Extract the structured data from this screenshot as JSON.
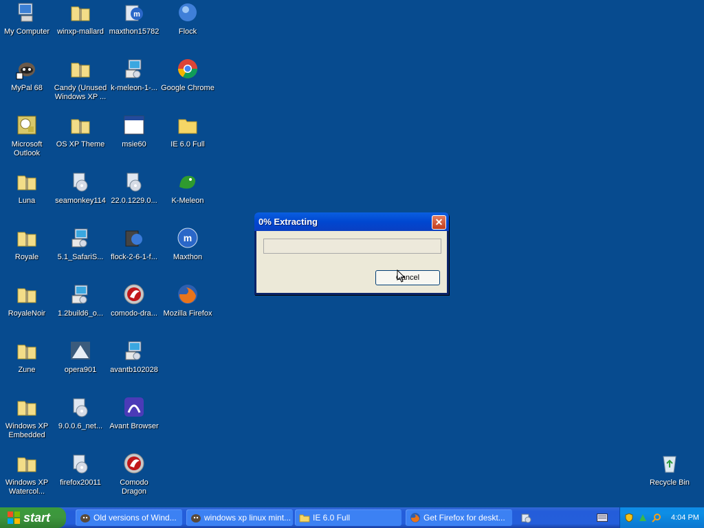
{
  "desktop": {
    "icons": [
      {
        "label": "My Computer",
        "icon": "computer-icon"
      },
      {
        "label": "winxp-mallard",
        "icon": "zip-folder-icon"
      },
      {
        "label": "maxthon15782",
        "icon": "maxthon-installer-icon"
      },
      {
        "label": "Flock",
        "icon": "flock-icon"
      },
      {
        "label": "MyPal 68",
        "icon": "mypal-icon"
      },
      {
        "label": "Candy (Unused Windows XP ...",
        "icon": "zip-folder-icon"
      },
      {
        "label": "k-meleon-1-...",
        "icon": "installer-icon"
      },
      {
        "label": "Google Chrome",
        "icon": "chrome-icon"
      },
      {
        "label": "Microsoft Outlook",
        "icon": "outlook-icon"
      },
      {
        "label": "OS XP Theme",
        "icon": "zip-folder-icon"
      },
      {
        "label": "msie60",
        "icon": "window-icon"
      },
      {
        "label": "IE 6.0 Full",
        "icon": "folder-icon"
      },
      {
        "label": "Luna",
        "icon": "zip-folder-icon"
      },
      {
        "label": "seamonkey114",
        "icon": "installer-cd-icon"
      },
      {
        "label": "22.0.1229.0...",
        "icon": "installer-cd-icon"
      },
      {
        "label": "K-Meleon",
        "icon": "kmeleon-icon"
      },
      {
        "label": "Royale",
        "icon": "zip-folder-icon"
      },
      {
        "label": "5.1_SafariS...",
        "icon": "installer-icon"
      },
      {
        "label": "flock-2-6-1-f...",
        "icon": "installer-icon"
      },
      {
        "label": "Maxthon",
        "icon": "maxthon-icon"
      },
      {
        "label": "RoyaleNoir",
        "icon": "zip-folder-icon"
      },
      {
        "label": "1.2build6_o...",
        "icon": "installer-icon"
      },
      {
        "label": "comodo-dra...",
        "icon": "comodo-icon"
      },
      {
        "label": "Mozilla Firefox",
        "icon": "firefox-icon"
      },
      {
        "label": "Zune",
        "icon": "zip-folder-icon"
      },
      {
        "label": "opera901",
        "icon": "opera-installer-icon"
      },
      {
        "label": "avantb102028",
        "icon": "installer-icon"
      },
      {
        "label": "Windows XP Embedded",
        "icon": "zip-folder-icon"
      },
      {
        "label": "9.0.0.6_net...",
        "icon": "installer-cd-icon"
      },
      {
        "label": "Avant Browser",
        "icon": "avant-icon"
      },
      {
        "label": "Windows XP Watercol...",
        "icon": "zip-folder-icon"
      },
      {
        "label": "firefox20011",
        "icon": "installer-cd-icon"
      },
      {
        "label": "Comodo Dragon",
        "icon": "comodo-icon"
      },
      {
        "label": "Recycle Bin",
        "icon": "recycle-bin-icon"
      }
    ]
  },
  "dialog": {
    "title": "0% Extracting",
    "progress_fraction": 0,
    "cancel_label": "Cancel",
    "close_glyph": "✕"
  },
  "taskbar": {
    "start_label": "start",
    "tasks": [
      {
        "label": "Old versions of Wind..."
      },
      {
        "label": "windows xp linux mint..."
      },
      {
        "label": "IE 6.0 Full"
      },
      {
        "label": "Get Firefox for deskt..."
      }
    ],
    "clock": "4:04 PM"
  },
  "colors": {
    "desktop": "#074b8f",
    "taskbar": "#245edb",
    "start": "#3d953d",
    "dialog_title": "#0047d0"
  }
}
